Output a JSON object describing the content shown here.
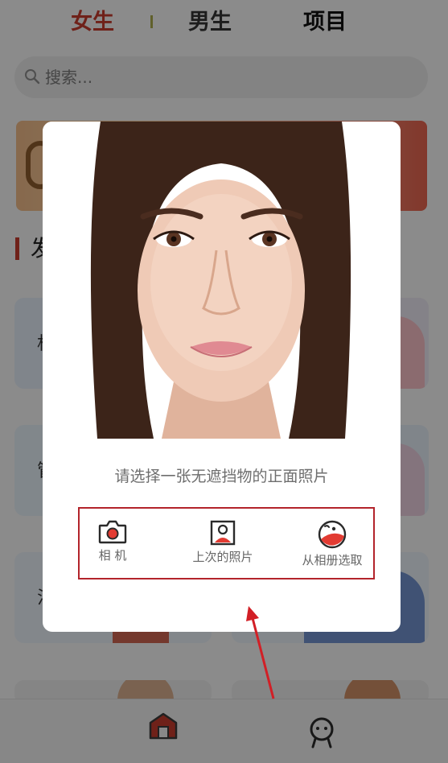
{
  "header": {
    "tabs": [
      {
        "label": "女生",
        "active": true
      },
      {
        "label": "男生",
        "active": false
      },
      {
        "label": "项目",
        "active": false
      }
    ]
  },
  "search": {
    "placeholder": "搜索..."
  },
  "section": {
    "title": "发"
  },
  "cards": [
    {
      "label": "相"
    },
    {
      "label": "管"
    },
    {
      "label": "法"
    }
  ],
  "modal": {
    "prompt": "请选择一张无遮挡物的正面照片",
    "options": [
      {
        "label": "相 机",
        "icon": "camera-icon"
      },
      {
        "label": "上次的照片",
        "icon": "portrait-photo-icon"
      },
      {
        "label": "从相册选取",
        "icon": "album-face-icon"
      }
    ]
  },
  "bottom_nav": {
    "items": [
      {
        "icon": "home-icon",
        "active": true
      },
      {
        "icon": "face-profile-icon",
        "active": false
      }
    ]
  },
  "colors": {
    "accent": "#c0392b",
    "highlight_box": "#b3242b",
    "annotation_arrow": "#d21f26"
  }
}
